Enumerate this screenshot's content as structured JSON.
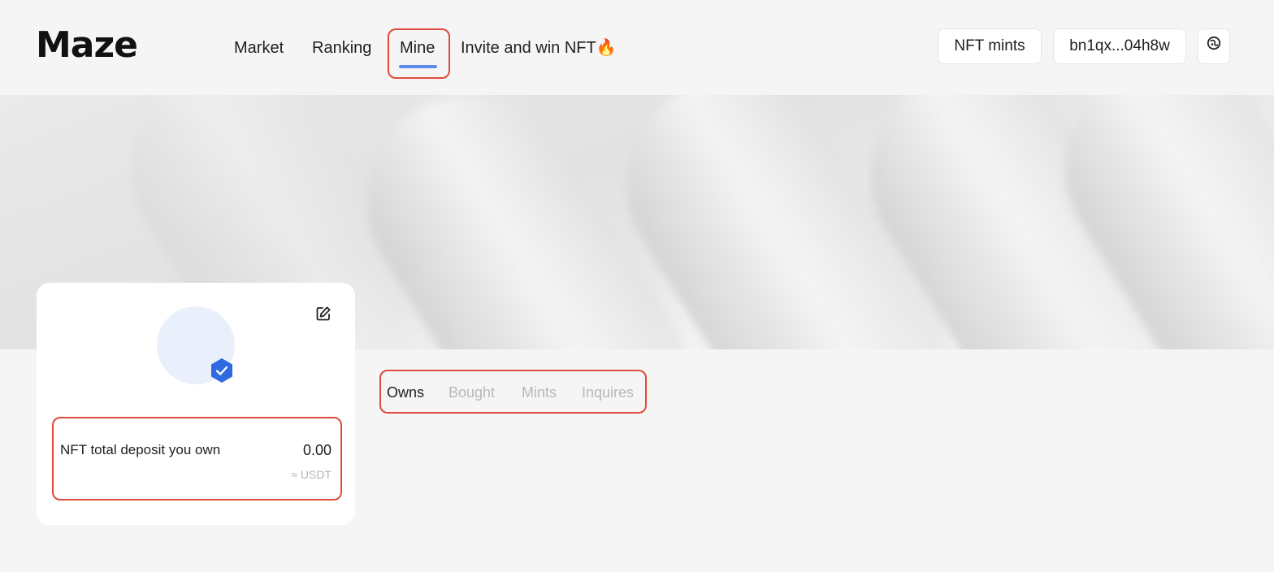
{
  "header": {
    "logo": "Maze",
    "nav": {
      "market": "Market",
      "ranking": "Ranking",
      "mine": "Mine",
      "invite": "Invite and win NFT🔥"
    },
    "active_nav": "Mine",
    "nft_mints_button": "NFT mints",
    "wallet_address": "bn1qx...04h8w",
    "icon_button": "theme-icon"
  },
  "profile": {
    "deposit_label": "NFT total deposit you own",
    "deposit_value": "0.00",
    "deposit_unit": "≈ USDT"
  },
  "tabs": {
    "owns": "Owns",
    "bought": "Bought",
    "mints": "Mints",
    "inquires": "Inquires",
    "active": "Owns"
  },
  "colors": {
    "accent": "#5b8de8",
    "highlight_border": "#e04a3a",
    "verified_badge": "#2f6ae0"
  }
}
